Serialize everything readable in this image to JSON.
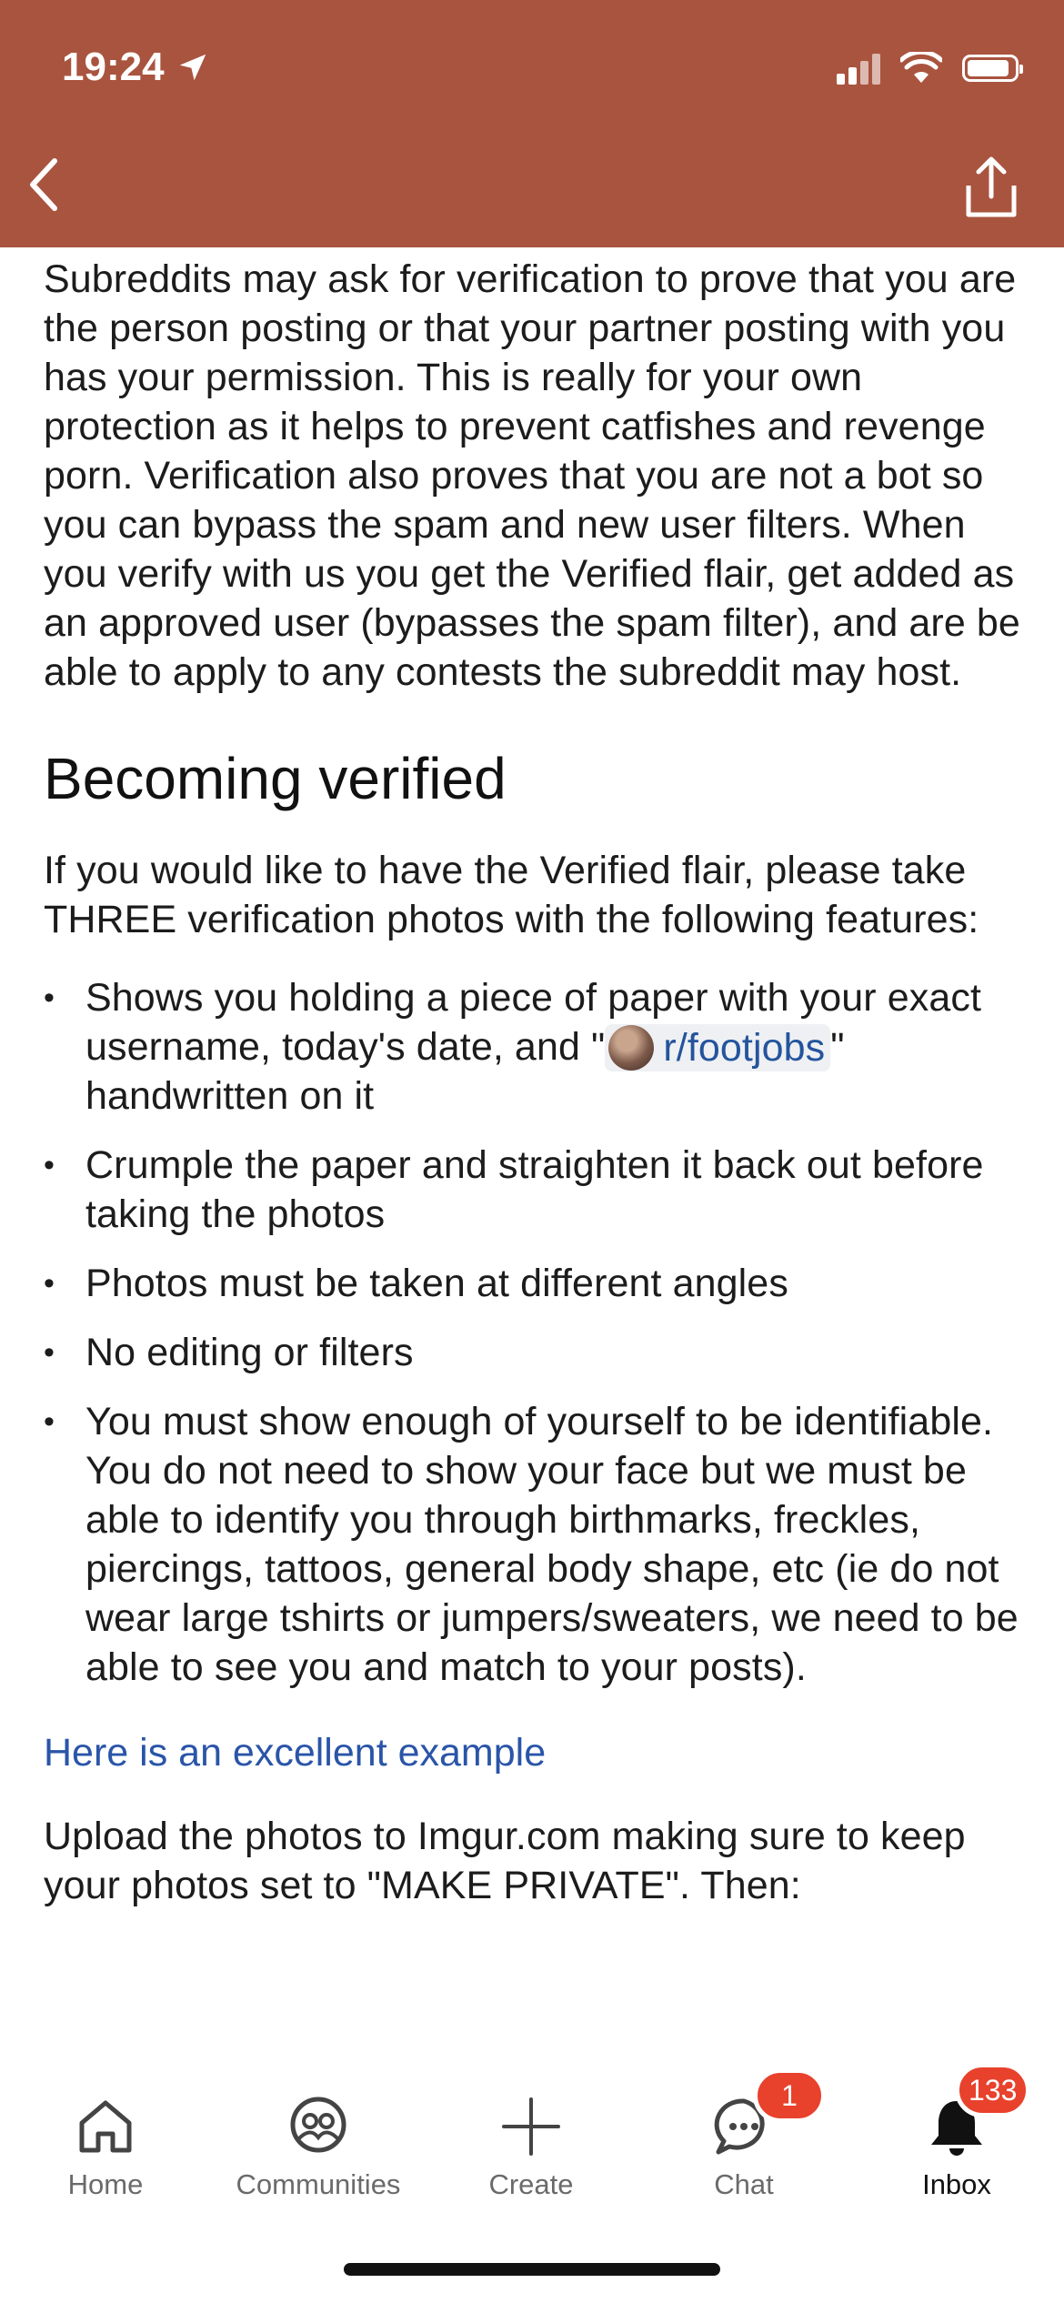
{
  "status_bar": {
    "time": "19:24"
  },
  "header": {
    "back_icon": "chevron-left-icon",
    "share_icon": "share-icon"
  },
  "content": {
    "intro": "Subreddits may ask for verification to prove that you are the person posting or that your partner posting with you has your permission. This is really for your own protection as it helps to prevent catfishes and revenge porn. Verification also proves that you are not a bot so you can bypass the spam and new user filters. When you verify with us you get the Verified flair, get added as an approved user (bypasses the spam filter), and are be able to apply to any contests the subreddit  may host.",
    "section_title": "Becoming verified",
    "instructions": "If you would like to have the Verified flair, please take THREE verification photos with the following features:",
    "bullet1_pre": "Shows you holding a piece of paper with your exact username, today's date, and \"",
    "bullet1_link": "r/footjobs",
    "bullet1_post": "\" handwritten on it",
    "bullets": [
      "Crumple the paper and straighten it back out before taking the photos",
      "Photos must be taken at different angles",
      "No editing or filters",
      "You must show enough of yourself to be identifiable. You do not need to show your face but we must be able to identify you through birthmarks, freckles, piercings, tattoos, general body shape, etc (ie do not wear large tshirts or jumpers/sweaters, we need to be able to see you and match to your posts)."
    ],
    "example_link": "Here is an excellent example",
    "upload_text": "Upload the photos to Imgur.com making sure to keep your photos set to \"MAKE PRIVATE\". Then:"
  },
  "bottom_nav": {
    "items": [
      {
        "label": "Home",
        "icon": "home-icon"
      },
      {
        "label": "Communities",
        "icon": "communities-icon"
      },
      {
        "label": "Create",
        "icon": "plus-icon"
      },
      {
        "label": "Chat",
        "icon": "chat-icon",
        "badge": "1"
      },
      {
        "label": "Inbox",
        "icon": "bell-icon",
        "badge": "133",
        "active": true
      }
    ]
  },
  "colors": {
    "header_bg": "#a9543f",
    "link": "#2a55a8",
    "badge": "#e8412c"
  }
}
